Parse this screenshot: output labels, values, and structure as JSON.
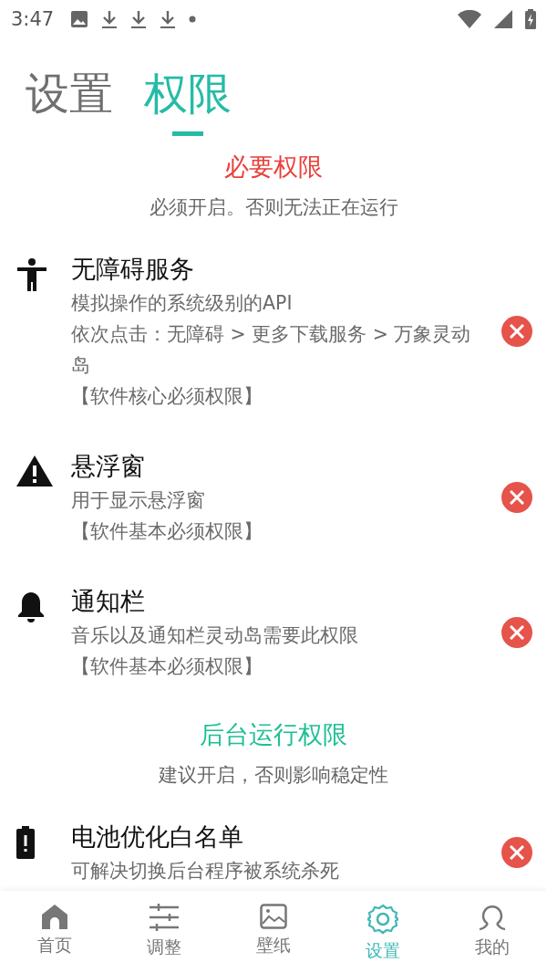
{
  "status_bar": {
    "time": "3:47",
    "notifications": [
      {
        "kind": "image"
      },
      {
        "kind": "download"
      },
      {
        "kind": "download"
      },
      {
        "kind": "download"
      },
      {
        "kind": "dot"
      }
    ]
  },
  "tabs": [
    {
      "label": "设置",
      "selected": false
    },
    {
      "label": "权限",
      "selected": true
    }
  ],
  "sections": [
    {
      "title": "必要权限",
      "color": "#e8413c",
      "subtitle": "必须开启。否则无法正在运行",
      "items": [
        {
          "kind": "accessibility",
          "title": "无障碍服务",
          "description": [
            "模拟操作的系统级别的API",
            "依次点击：无障碍 > 更多下载服务 > 万象灵动岛",
            "【软件核心必须权限】"
          ],
          "granted": false
        },
        {
          "kind": "warning",
          "title": "悬浮窗",
          "description": [
            "用于显示悬浮窗",
            "【软件基本必须权限】"
          ],
          "granted": false
        },
        {
          "kind": "bell",
          "title": "通知栏",
          "description": [
            "音乐以及通知栏灵动岛需要此权限",
            "【软件基本必须权限】"
          ],
          "granted": false
        }
      ]
    },
    {
      "title": "后台运行权限",
      "color": "#1fbf95",
      "subtitle": "建议开启，否则影响稳定性",
      "items": [
        {
          "kind": "battery",
          "title": "电池优化白名单",
          "description": [
            "可解决切换后台程序被系统杀死"
          ],
          "granted": false
        }
      ]
    }
  ],
  "bottom_nav": [
    {
      "kind": "home",
      "label": "首页",
      "selected": false
    },
    {
      "kind": "sliders",
      "label": "调整",
      "selected": false
    },
    {
      "kind": "wallpaper",
      "label": "壁纸",
      "selected": false
    },
    {
      "kind": "settings",
      "label": "设置",
      "selected": true
    },
    {
      "kind": "profile",
      "label": "我的",
      "selected": false
    }
  ]
}
